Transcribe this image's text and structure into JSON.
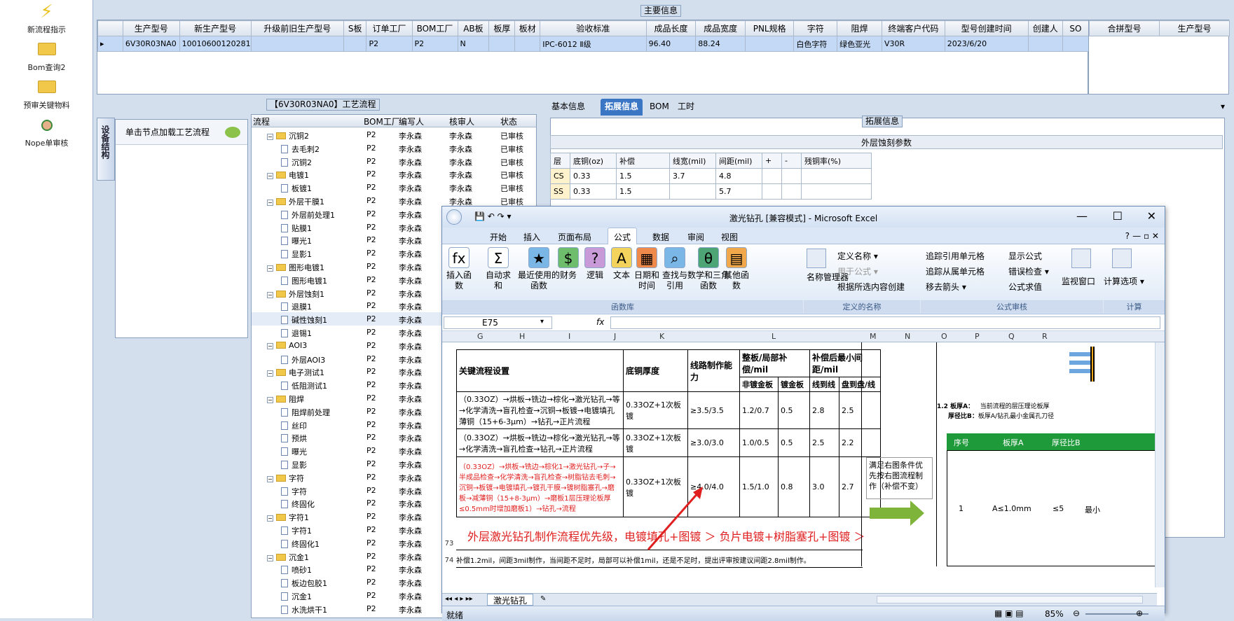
{
  "sidebar": {
    "items": [
      {
        "label": "新流程指示",
        "icon": "lightning-icon"
      },
      {
        "label": "Bom查询2",
        "icon": "folder-icon"
      },
      {
        "label": "预审关键物料",
        "icon": "folder-icon"
      },
      {
        "label": "Nope单审核",
        "icon": "user-icon"
      }
    ]
  },
  "main_info": {
    "legend": "主要信息",
    "columns": [
      "生产型号",
      "新生产型号",
      "升级前旧生产型号",
      "S板",
      "订单工厂",
      "BOM工厂",
      "AB板",
      "板厚",
      "板材",
      "验收标准",
      "成品长度",
      "成品宽度",
      "PNL规格",
      "字符",
      "阻焊",
      "终端客户代码",
      "型号创建时间",
      "创建人",
      "SO"
    ],
    "row": [
      "6V30R03NA0",
      "10010600120281",
      "",
      "",
      "P2",
      "P2",
      "N",
      "",
      "",
      "IPC-6012 Ⅱ级",
      "96.40",
      "88.24",
      "",
      "白色字符",
      "绿色亚光",
      "V30R",
      "2023/6/20",
      "",
      ""
    ]
  },
  "hebing": {
    "columns": [
      "合拼型号",
      "生产型号"
    ]
  },
  "flow": {
    "legend": "【6V30R03NA0】工艺流程",
    "vertical_tab": "设备结构",
    "load_hint": "单击节点加载工艺流程",
    "headers": [
      "流程",
      "BOM工厂",
      "编写人",
      "核审人",
      "状态"
    ],
    "rows": [
      {
        "name": "沉铜2",
        "folder": true,
        "f": "P2",
        "w": "李永森",
        "r": "李永森",
        "s": "已审核",
        "level": 1
      },
      {
        "name": "去毛刺2",
        "folder": false,
        "f": "P2",
        "w": "李永森",
        "r": "李永森",
        "s": "已审核",
        "level": 2
      },
      {
        "name": "沉铜2",
        "folder": false,
        "f": "P2",
        "w": "李永森",
        "r": "李永森",
        "s": "已审核",
        "level": 2
      },
      {
        "name": "电镀1",
        "folder": true,
        "f": "P2",
        "w": "李永森",
        "r": "李永森",
        "s": "已审核",
        "level": 1
      },
      {
        "name": "板镀1",
        "folder": false,
        "f": "P2",
        "w": "李永森",
        "r": "李永森",
        "s": "已审核",
        "level": 2
      },
      {
        "name": "外层干膜1",
        "folder": true,
        "f": "P2",
        "w": "李永森",
        "r": "李永森",
        "s": "已审核",
        "level": 1
      },
      {
        "name": "外层前处理1",
        "folder": false,
        "f": "P2",
        "w": "李永森",
        "r": "李永森",
        "s": "已审核",
        "level": 2
      },
      {
        "name": "贴膜1",
        "folder": false,
        "f": "P2",
        "w": "李永森",
        "r": "李永森",
        "s": "已审核",
        "level": 2
      },
      {
        "name": "曝光1",
        "folder": false,
        "f": "P2",
        "w": "李永森",
        "r": "李永森",
        "s": "已审核",
        "level": 2
      },
      {
        "name": "显影1",
        "folder": false,
        "f": "P2",
        "w": "李永森",
        "r": "李永森",
        "s": "已审核",
        "level": 2
      },
      {
        "name": "图形电镀1",
        "folder": true,
        "f": "P2",
        "w": "李永森",
        "r": "李永森",
        "s": "已审核",
        "level": 1
      },
      {
        "name": "图形电镀1",
        "folder": false,
        "f": "P2",
        "w": "李永森",
        "r": "李永森",
        "s": "已审核",
        "level": 2
      },
      {
        "name": "外层蚀刻1",
        "folder": true,
        "f": "P2",
        "w": "李永森",
        "r": "李永森",
        "s": "已审核",
        "level": 1
      },
      {
        "name": "退膜1",
        "folder": false,
        "f": "P2",
        "w": "李永森",
        "r": "李永森",
        "s": "已审核",
        "level": 2
      },
      {
        "name": "碱性蚀刻1",
        "folder": false,
        "f": "P2",
        "w": "李永森",
        "r": "李永森",
        "s": "已审核",
        "level": 2
      },
      {
        "name": "退锡1",
        "folder": false,
        "f": "P2",
        "w": "李永森",
        "r": "李永森",
        "s": "已审核",
        "level": 2
      },
      {
        "name": "AOI3",
        "folder": true,
        "f": "P2",
        "w": "李永森",
        "r": "李永森",
        "s": "已审核",
        "level": 1
      },
      {
        "name": "外层AOI3",
        "folder": false,
        "f": "P2",
        "w": "李永森",
        "r": "李永森",
        "s": "已审核",
        "level": 2
      },
      {
        "name": "电子测试1",
        "folder": true,
        "f": "P2",
        "w": "李永森",
        "r": "李永森",
        "s": "已审核",
        "level": 1
      },
      {
        "name": "低阻测试1",
        "folder": false,
        "f": "P2",
        "w": "李永森",
        "r": "李永森",
        "s": "已审核",
        "level": 2
      },
      {
        "name": "阻焊",
        "folder": true,
        "f": "P2",
        "w": "李永森",
        "r": "李永森",
        "s": "已审核",
        "level": 1
      },
      {
        "name": "阻焊前处理",
        "folder": false,
        "f": "P2",
        "w": "李永森",
        "r": "李永森",
        "s": "已审核",
        "level": 2
      },
      {
        "name": "丝印",
        "folder": false,
        "f": "P2",
        "w": "李永森",
        "r": "李永森",
        "s": "已审核",
        "level": 2
      },
      {
        "name": "预烘",
        "folder": false,
        "f": "P2",
        "w": "李永森",
        "r": "李永森",
        "s": "已审核",
        "level": 2
      },
      {
        "name": "曝光",
        "folder": false,
        "f": "P2",
        "w": "李永森",
        "r": "李永森",
        "s": "已审核",
        "level": 2
      },
      {
        "name": "显影",
        "folder": false,
        "f": "P2",
        "w": "李永森",
        "r": "李永森",
        "s": "已审核",
        "level": 2
      },
      {
        "name": "字符",
        "folder": true,
        "f": "P2",
        "w": "李永森",
        "r": "李永森",
        "s": "已审核",
        "level": 1
      },
      {
        "name": "字符",
        "folder": false,
        "f": "P2",
        "w": "李永森",
        "r": "李永森",
        "s": "已审核",
        "level": 2
      },
      {
        "name": "终固化",
        "folder": false,
        "f": "P2",
        "w": "李永森",
        "r": "李永森",
        "s": "已审核",
        "level": 2
      },
      {
        "name": "字符1",
        "folder": true,
        "f": "P2",
        "w": "李永森",
        "r": "李永森",
        "s": "已审核",
        "level": 1
      },
      {
        "name": "字符1",
        "folder": false,
        "f": "P2",
        "w": "李永森",
        "r": "李永森",
        "s": "已审核",
        "level": 2
      },
      {
        "name": "终固化1",
        "folder": false,
        "f": "P2",
        "w": "李永森",
        "r": "李永森",
        "s": "已审核",
        "level": 2
      },
      {
        "name": "沉金1",
        "folder": true,
        "f": "P2",
        "w": "李永森",
        "r": "李永森",
        "s": "已审核",
        "level": 1
      },
      {
        "name": "喷砂1",
        "folder": false,
        "f": "P2",
        "w": "李永森",
        "r": "李永森",
        "s": "已审核",
        "level": 2
      },
      {
        "name": "板边包胶1",
        "folder": false,
        "f": "P2",
        "w": "李永森",
        "r": "李永森",
        "s": "已审核",
        "level": 2
      },
      {
        "name": "沉金1",
        "folder": false,
        "f": "P2",
        "w": "李永森",
        "r": "李永森",
        "s": "已审核",
        "level": 2
      },
      {
        "name": "水洗烘干1",
        "folder": false,
        "f": "P2",
        "w": "李永森",
        "r": "李永森",
        "s": "已审核",
        "level": 2
      }
    ]
  },
  "right_tabs": [
    "基本信息",
    "拓展信息",
    "BOM",
    "工时"
  ],
  "ext": {
    "legend": "拓展信息",
    "title": "外层蚀刻参数",
    "headers": [
      "层",
      "底铜(oz)",
      "补偿",
      "线宽(mil)",
      "间距(mil)",
      "+",
      "-",
      "残铜率(%)"
    ],
    "rows": [
      [
        "CS",
        "0.33",
        "1.5",
        "3.7",
        "4.8",
        "",
        "",
        ""
      ],
      [
        "SS",
        "0.33",
        "1.5",
        "",
        "5.7",
        "",
        "",
        ""
      ]
    ]
  },
  "excel": {
    "title": "激光钻孔  [兼容模式] - Microsoft Excel",
    "tabs": [
      "开始",
      "插入",
      "页面布局",
      "公式",
      "数据",
      "审阅",
      "视图"
    ],
    "active_tab": "公式",
    "buttons": [
      {
        "label": "插入函数",
        "icon": "fx"
      },
      {
        "label": "自动求和",
        "icon": "Σ"
      },
      {
        "label": "最近使用的函数",
        "icon": "★"
      },
      {
        "label": "财务",
        "icon": "$"
      },
      {
        "label": "逻辑",
        "icon": "?"
      },
      {
        "label": "文本",
        "icon": "A"
      },
      {
        "label": "日期和时间",
        "icon": "▦"
      },
      {
        "label": "查找与引用",
        "icon": "⌕"
      },
      {
        "label": "数学和三角函数",
        "icon": "θ"
      },
      {
        "label": "其他函数",
        "icon": "▤"
      }
    ],
    "name_group": [
      "名称管理器",
      "定义名称",
      "用于公式",
      "根据所选内容创建"
    ],
    "audit_group": [
      "追踪引用单元格",
      "追踪从属单元格",
      "移去箭头",
      "显示公式",
      "错误检查",
      "公式求值",
      "监视窗口"
    ],
    "calc_group": [
      "计算选项"
    ],
    "group_labels": [
      "函数库",
      "定义的名称",
      "公式审核",
      "计算"
    ],
    "name_box": "E75",
    "fx": "fx",
    "columns": [
      "G",
      "H",
      "I",
      "J",
      "K",
      "L",
      "M",
      "N",
      "O",
      "P",
      "Q",
      "R"
    ],
    "table_headers": [
      "关键流程设置",
      "底铜厚度",
      "线路制作能力",
      "整板/局部补偿/mil",
      "补偿后最小间距/mil",
      "非镀金板",
      "镀金板",
      "线到线",
      "盘到盘/线"
    ],
    "table_rows": [
      {
        "flow": "（0.33OZ）→烘板→铣边→棕化→激光钻孔→等→化学清洗→盲孔检查→沉铜→板镀→电镀填孔薄铜（15+6-3μm）→钻孔→正片流程",
        "cu": "0.33OZ+1次板镀",
        "cap": "≥3.5/3.5",
        "a": "1.2/0.7",
        "b": "0.5",
        "c": "2.8",
        "d": "2.5"
      },
      {
        "flow": "（0.33OZ）→烘板→铣边→棕化→激光钻孔→等→化学清洗→盲孔检查→钻孔→正片流程",
        "cu": "0.33OZ+1次板镀",
        "cap": "≥3.0/3.0",
        "a": "1.0/0.5",
        "b": "0.5",
        "c": "2.5",
        "d": "2.2"
      },
      {
        "flow": "（0.33OZ）→烘板→铣边→棕化1→激光钻孔→子→半成品检查→化学清洗→盲孔检查→树脂钻去毛刺→沉铜→板镀→电镀填孔→镀孔干膜→镀树脂塞孔→磨板→减薄铜（15+8-3μm）→磨板1层压理论板厚≤0.5mm时增加磨板1）→钻孔→流程",
        "cu": "0.33OZ+1次板镀",
        "cap": "≥4.0/4.0",
        "a": "1.5/1.0",
        "b": "0.8",
        "c": "3.0",
        "d": "2.7"
      }
    ],
    "side_note": "满足右图条件优先按右图流程制作（补偿不变）",
    "priority_text": "外层激光钻孔制作流程优先级，电镀填孔+图镀 ＞ 负片电镀+树脂塞孔+图镀 ＞",
    "note_row": "补偿1.2mil，间距3mil制作，当间距不足时，局部可以补偿1mil，还是不足时，提出评审按建议间距2.8mil制作。",
    "row_nums": [
      "73",
      "74"
    ],
    "right_labels": [
      "1.2 板厚A：",
      "当前流程的层压理论板厚",
      "厚径比B：",
      "板厚A/钻孔最小金属孔刀径"
    ],
    "right_headers": [
      "序号",
      "板厚A",
      "厚径比B"
    ],
    "right_row": [
      "1",
      "A≤1.0mm",
      "≤5",
      "最小"
    ],
    "sheet_tab": "激光钻孔",
    "status": "就绪",
    "zoom": "85%"
  },
  "colors": {
    "accent": "#3b76c5",
    "selected_row": "#c3d9f5",
    "red": "#e02020",
    "green": "#1e8a1e",
    "arrow_green": "#7fb43a"
  }
}
